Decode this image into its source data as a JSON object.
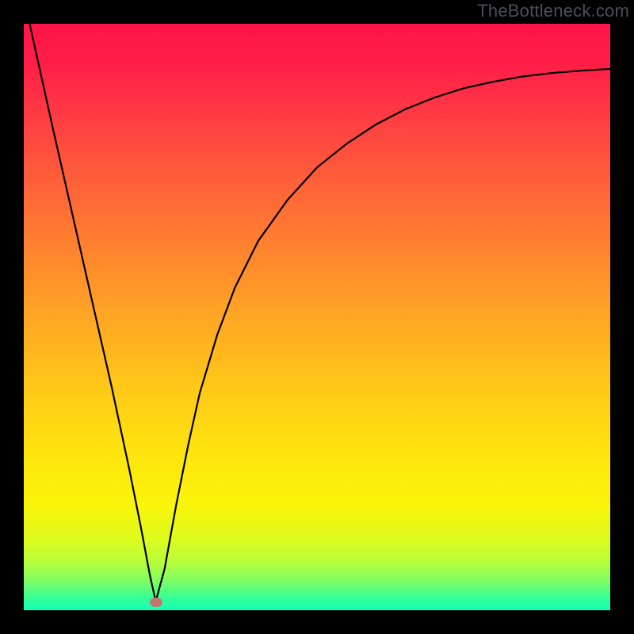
{
  "watermark": "TheBottleneck.com",
  "marker": {
    "x_pct": 22.5,
    "y_pct": 98.6
  },
  "chart_data": {
    "type": "line",
    "title": "",
    "xlabel": "",
    "ylabel": "",
    "xlim": [
      0,
      100
    ],
    "ylim": [
      0,
      100
    ],
    "series": [
      {
        "name": "curve",
        "x": [
          1,
          5,
          10,
          15,
          18,
          20,
          21.5,
          22.5,
          24,
          26,
          28,
          30,
          33,
          36,
          40,
          45,
          50,
          55,
          60,
          65,
          70,
          75,
          80,
          85,
          90,
          95,
          100
        ],
        "y": [
          100,
          82,
          60,
          38,
          24,
          14,
          6,
          1.5,
          7,
          18,
          28,
          37,
          47,
          55,
          63,
          70,
          75.5,
          79.5,
          82.8,
          85.4,
          87.4,
          89.0,
          90.1,
          91.0,
          91.6,
          92.0,
          92.3
        ]
      }
    ],
    "gradient_stops": [
      {
        "pct": 0,
        "color": "#ff1448"
      },
      {
        "pct": 7,
        "color": "#ff1f48"
      },
      {
        "pct": 15,
        "color": "#ff3944"
      },
      {
        "pct": 25,
        "color": "#ff5a3b"
      },
      {
        "pct": 37,
        "color": "#ff7f30"
      },
      {
        "pct": 50,
        "color": "#ffa624"
      },
      {
        "pct": 62,
        "color": "#ffc818"
      },
      {
        "pct": 73,
        "color": "#ffe40e"
      },
      {
        "pct": 82,
        "color": "#faf50a"
      },
      {
        "pct": 88,
        "color": "#ddfb1e"
      },
      {
        "pct": 92,
        "color": "#b4fd3d"
      },
      {
        "pct": 95,
        "color": "#7efe65"
      },
      {
        "pct": 98,
        "color": "#34ff99"
      },
      {
        "pct": 100,
        "color": "#14ffb6"
      }
    ],
    "marker_point": {
      "x": 22.5,
      "y": 1.5,
      "color": "#c6746d"
    }
  }
}
